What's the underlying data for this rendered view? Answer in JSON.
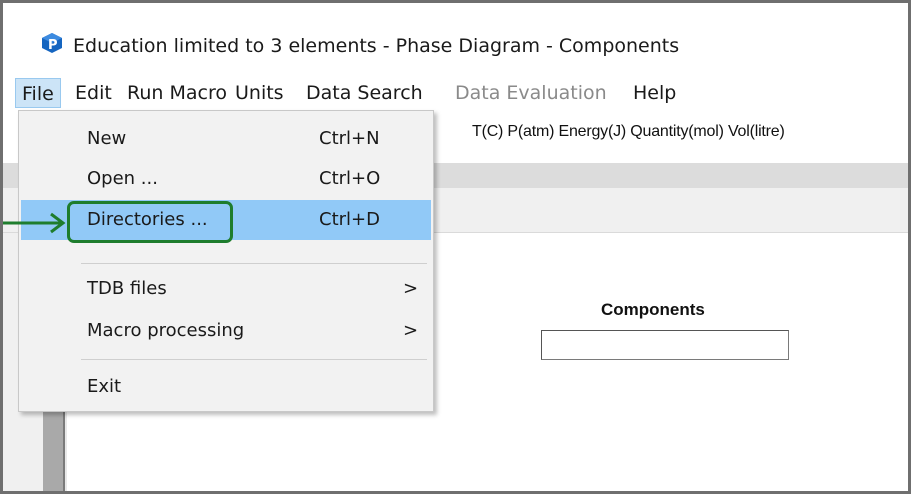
{
  "window": {
    "title": "Education limited to 3 elements  - Phase Diagram - Components",
    "app_icon": "p-logo-icon"
  },
  "menubar": {
    "items": [
      {
        "label": "File",
        "active": true
      },
      {
        "label": "Edit"
      },
      {
        "label": "Run Macro"
      },
      {
        "label": "Units"
      },
      {
        "label": "Data Search"
      },
      {
        "label": "Data Evaluation",
        "disabled": true
      },
      {
        "label": "Help"
      }
    ]
  },
  "units_bar": {
    "text": "T(C)  P(atm)  Energy(J)  Quantity(mol)  Vol(litre)"
  },
  "main": {
    "components_label": "Components",
    "components_value": ""
  },
  "file_menu": {
    "items": [
      {
        "label": "New",
        "shortcut": "Ctrl+N"
      },
      {
        "label": "Open ...",
        "shortcut": "Ctrl+O"
      },
      {
        "label": "Directories ...",
        "shortcut": "Ctrl+D",
        "highlighted": true
      },
      {
        "label": "TDB files",
        "submenu": ">"
      },
      {
        "label": "Macro processing",
        "submenu": ">"
      },
      {
        "label": "Exit"
      }
    ]
  },
  "colors": {
    "highlight": "#91c9f7",
    "annotation": "#1e7d2d",
    "menu_active": "#cce4f7",
    "disabled_text": "#8a8a8a"
  }
}
